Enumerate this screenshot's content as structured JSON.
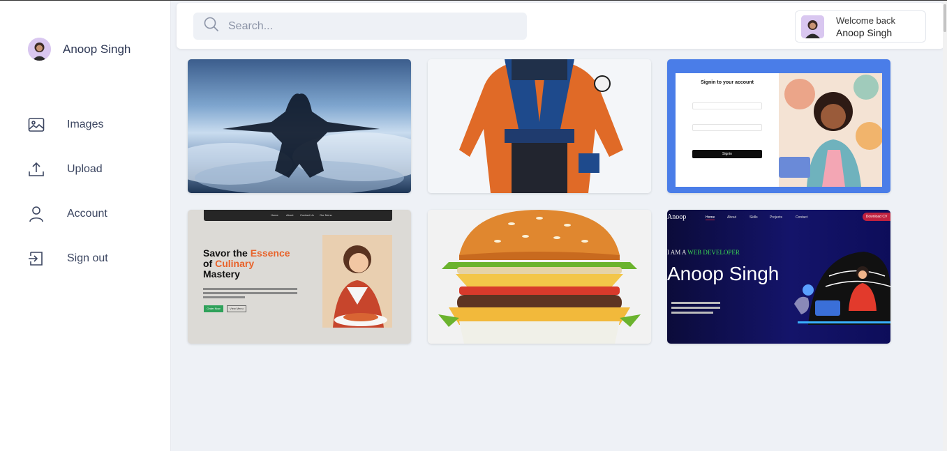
{
  "sidebar": {
    "profile_name": "Anoop Singh",
    "items": [
      {
        "label": "Images",
        "icon": "image-icon"
      },
      {
        "label": "Upload",
        "icon": "upload-icon"
      },
      {
        "label": "Account",
        "icon": "user-icon"
      },
      {
        "label": "Sign out",
        "icon": "sign-out-icon"
      }
    ]
  },
  "header": {
    "search_placeholder": "Search...",
    "welcome_label": "Welcome back",
    "user_name": "Anoop Singh"
  },
  "gallery": {
    "card3": {
      "title": "Signin to your account",
      "button": "Signin"
    },
    "card4": {
      "nav": [
        "Home",
        "About",
        "Contact Us",
        "Our Menu"
      ],
      "headline_1": "Savor the ",
      "headline_accent_1": "Essence",
      "headline_2": "of ",
      "headline_accent_2": "Culinary",
      "headline_3": "Mastery",
      "btn_1": "Order Now",
      "btn_2": "View Menu"
    },
    "card6": {
      "logo": "Anoop",
      "nav": [
        "Home",
        "About",
        "Skills",
        "Projects",
        "Contact"
      ],
      "cta": "Download CV",
      "tagline_prefix": "I AM A ",
      "tagline_accent": "WEB DEVELOPER",
      "name": "Anoop Singh"
    }
  },
  "colors": {
    "accent_orange": "#e8632b",
    "accent_green": "#39d353",
    "cta_red": "#c0213f"
  }
}
